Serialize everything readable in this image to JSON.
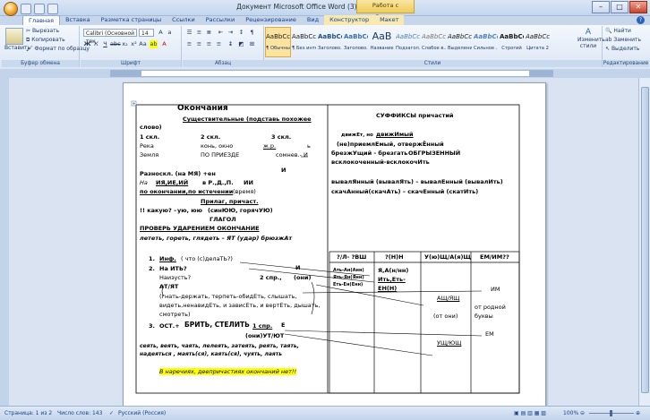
{
  "window": {
    "title": "Документ Microsoft Office Word (3) - Microsoft Word",
    "context_tab_group": "Работа с таблицами",
    "minimize": "–",
    "maximize": "□",
    "close": "✕"
  },
  "tabs": [
    "Главная",
    "Вставка",
    "Разметка страницы",
    "Ссылки",
    "Рассылки",
    "Рецензирование",
    "Вид",
    "Конструктор",
    "Макет"
  ],
  "ribbon": {
    "clipboard": {
      "paste": "Вставить",
      "cut": "Вырезать",
      "copy": "Копировать",
      "format_painter": "Формат по образцу",
      "label": "Буфер обмена"
    },
    "font": {
      "name": "Calibri (Основной тек",
      "size": "14",
      "label": "Шрифт"
    },
    "paragraph": {
      "label": "Абзац"
    },
    "styles": {
      "label": "Стили",
      "items": [
        {
          "sample": "AaBbCcDc",
          "name": "¶ Обычный"
        },
        {
          "sample": "AaBbCcDc",
          "name": "¶ Без инте..."
        },
        {
          "sample": "AaBbCc",
          "name": "Заголово..."
        },
        {
          "sample": "AaBbCc",
          "name": "Заголово..."
        },
        {
          "sample": "AaB",
          "name": "Название"
        },
        {
          "sample": "AaBbCc.",
          "name": "Подзагол..."
        },
        {
          "sample": "AaBbCcDc",
          "name": "Слабое в..."
        },
        {
          "sample": "AaBbCcDc",
          "name": "Выделение"
        },
        {
          "sample": "AaBbCcDc",
          "name": "Сильное ..."
        },
        {
          "sample": "AaBbCcDc",
          "name": "Строгий"
        },
        {
          "sample": "AaBbCcDc",
          "name": "Цитата 2"
        }
      ],
      "change": "Изменить стили"
    },
    "editing": {
      "find": "Найти",
      "replace": "Заменить",
      "select": "Выделить",
      "label": "Редактирование"
    }
  },
  "document": {
    "left": {
      "title": "Окончания",
      "sub1": "Существительные (подставь похожее",
      "sub1b": "слово)",
      "decl": [
        "1 скл.",
        "2 скл.",
        "3 скл."
      ],
      "row1": [
        "Река",
        "конь, окно",
        "ж.р.",
        "ь"
      ],
      "row2": [
        "Земля",
        "ПО ПРИЕЗДЕ",
        "сомнев.- И"
      ],
      "razno": "Разноскл. (на МЯ) +ен",
      "razno_i": "И",
      "na": "На",
      "ija": "ИЯ,ИЕ,ИЙ",
      "vpdp": "в Р.,Д.,П.",
      "ii": "ИИ",
      "po": "по окончании,по истечении",
      "vremya": "(время)",
      "prilag": "Прилаг, причаст.",
      "kakuyu_a": "!! какую? –",
      "kakuyu_b": "ую, юю",
      "kakuyu_c": "(синЮЮ, горячУЮ)",
      "glagol": "ГЛАГОЛ",
      "prover": "ПРОВЕРЬ УДАРЕНИЕМ ОКОНЧАНИЕ",
      "example": "лететь, гореть, глядеть – ЯТ (удар) брюзжАт",
      "n1": "1.",
      "inf": "Инф.",
      "inf_b": "(   что (с)делаТЬ?)",
      "n2": "2.",
      "naity": "На ИТЬ?",
      "i_mark": "И",
      "naizust": "Наизусть?",
      "spr2": "2 спр.,",
      "oni": "(они)",
      "atyat": "АТ/ЯТ",
      "gnat1": "(гнать-держать, терпеть-обидЕть, слышать,",
      "gnat2": "видеть,ненавидЕть, и завиcЕть, и вертЕть, дышать,",
      "gnat3": "смотреть)",
      "n3": "3.",
      "ost": "ОСТ.+",
      "brit": "БРИТЬ, СТЕЛИТЬ",
      "spr1": "1 спр.",
      "e": "Е",
      "ut": "(они)УТ/ЮТ",
      "ex1": "сеять, веять, чаять, лелеять, затеять, реять, таять,",
      "ex2": "надеяться , маять(ся), каять(ся), чуять, лаять",
      "note": "В наречиях, деепричастиях окончаний нет!!"
    },
    "right": {
      "title": "СУФФИКСЫ  причастий",
      "l1a": "движЕт, но",
      "l1b": "движИмый",
      "l2": "(не)приемлЕмый, отвержЁнный",
      "l3a": "брезжУщий - брезгать",
      "l3b": "ОБГРЫЗЕННЫЙ",
      "l4": "всклокоченный-всклокочИть",
      "l5": "вывалЯнный (вывалЯть) – вывалЕнный (вывалИть)",
      "l6": "скачАнный(скачАть) – скачЕнный (скатИть)",
      "table_headers": [
        "?/Л- ?ВШ",
        "?(Н)Н",
        "У(ю)Щ/А(я)Щ",
        "ЕМ/ИМ??"
      ],
      "c1a": "Ать-Ан(Анн)",
      "c1b": "Ять-Ян(Янн)",
      "c1c": "Еть-Ен(Енн)",
      "c2a": "Я,А(н/нн)",
      "c2b": "Ить,Еть-",
      "c2c": "ЕН(Н)",
      "c3a": "АЩ/ЯЩ",
      "c3b": "(от они)",
      "c3c": "УЩ/ЮЩ",
      "c4a": "ИМ",
      "c4b": "от родной",
      "c4c": "буквы",
      "c4d": "ЕМ"
    }
  },
  "status": {
    "page": "Страница: 1 из 2",
    "words": "Число слов: 143",
    "language": "Русский (Россия)",
    "zoom": "100%"
  },
  "colors": {
    "accent_red": "#d40000",
    "ribbon_blue": "#15428b",
    "highlight": "#ffff00"
  }
}
